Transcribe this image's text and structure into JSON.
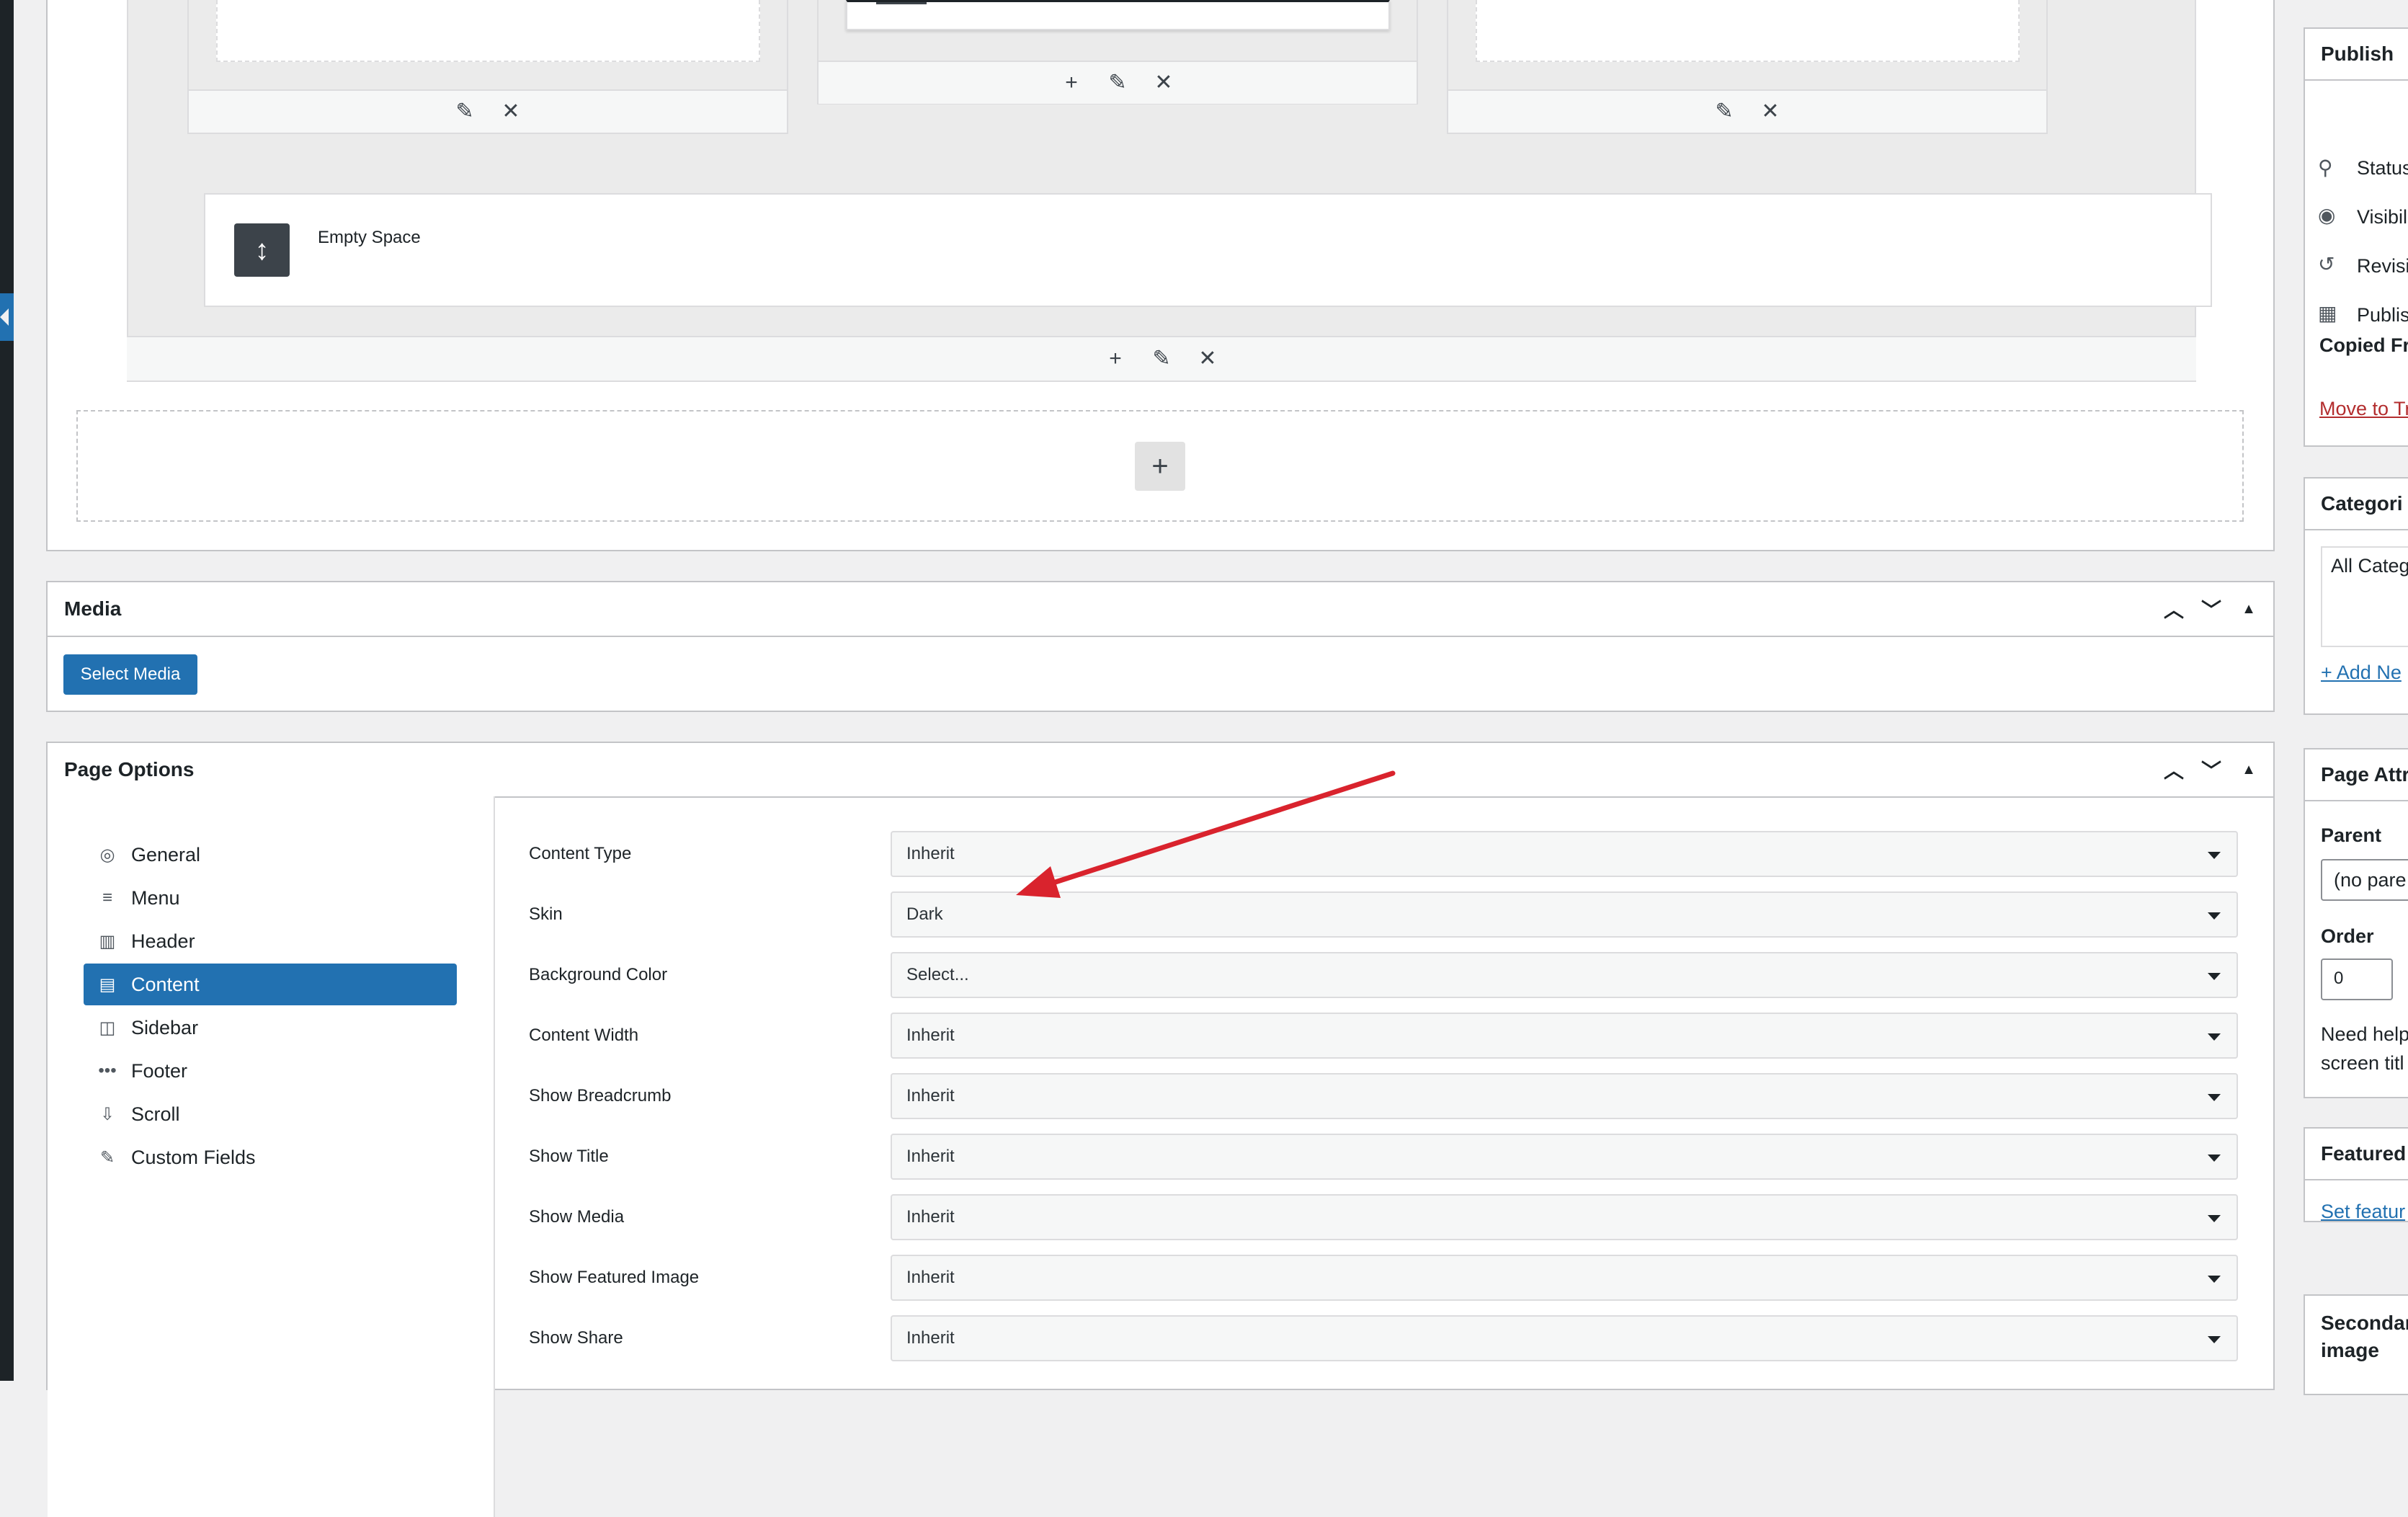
{
  "builder": {
    "empty_space_label": "Empty Space",
    "add_symbol": "+",
    "edit_symbol": "✎",
    "delete_symbol": "✕"
  },
  "media_box": {
    "title": "Media",
    "select_media_label": "Select Media"
  },
  "page_options": {
    "title": "Page Options",
    "nav": [
      {
        "label": "General",
        "icon": "globe-icon"
      },
      {
        "label": "Menu",
        "icon": "menu-icon"
      },
      {
        "label": "Header",
        "icon": "header-icon"
      },
      {
        "label": "Content",
        "icon": "content-icon",
        "active": true
      },
      {
        "label": "Sidebar",
        "icon": "sidebar-icon"
      },
      {
        "label": "Footer",
        "icon": "footer-icon"
      },
      {
        "label": "Scroll",
        "icon": "scroll-icon"
      },
      {
        "label": "Custom Fields",
        "icon": "pencil-icon"
      }
    ],
    "fields": [
      {
        "label": "Content Type",
        "value": "Inherit"
      },
      {
        "label": "Skin",
        "value": "Dark"
      },
      {
        "label": "Background Color",
        "value": "Select..."
      },
      {
        "label": "Content Width",
        "value": "Inherit"
      },
      {
        "label": "Show Breadcrumb",
        "value": "Inherit"
      },
      {
        "label": "Show Title",
        "value": "Inherit"
      },
      {
        "label": "Show Media",
        "value": "Inherit"
      },
      {
        "label": "Show Featured Image",
        "value": "Inherit"
      },
      {
        "label": "Show Share",
        "value": "Inherit"
      }
    ]
  },
  "sidebar": {
    "publish": {
      "title": "Publish",
      "status": "Status",
      "visibility": "Visibil",
      "revisions": "Revisi",
      "published": "Publis",
      "copied_from": "Copied Fr",
      "trash": "Move to Tr"
    },
    "categories": {
      "title": "Categori",
      "tab": "All Categ",
      "add_new": "+ Add Ne"
    },
    "page_attributes": {
      "title": "Page Attr",
      "parent_label": "Parent",
      "parent_value": "(no pare",
      "order_label": "Order",
      "order_value": "0",
      "help_1": "Need help",
      "help_2": "screen titl"
    },
    "featured": {
      "title": "Featured",
      "link": "Set featur"
    },
    "secondary": {
      "title_1": "Secondar",
      "title_2": "image"
    }
  },
  "colors": {
    "accent": "#2271b1",
    "annotation_arrow": "#d9232d",
    "trash": "#b32d2e"
  }
}
